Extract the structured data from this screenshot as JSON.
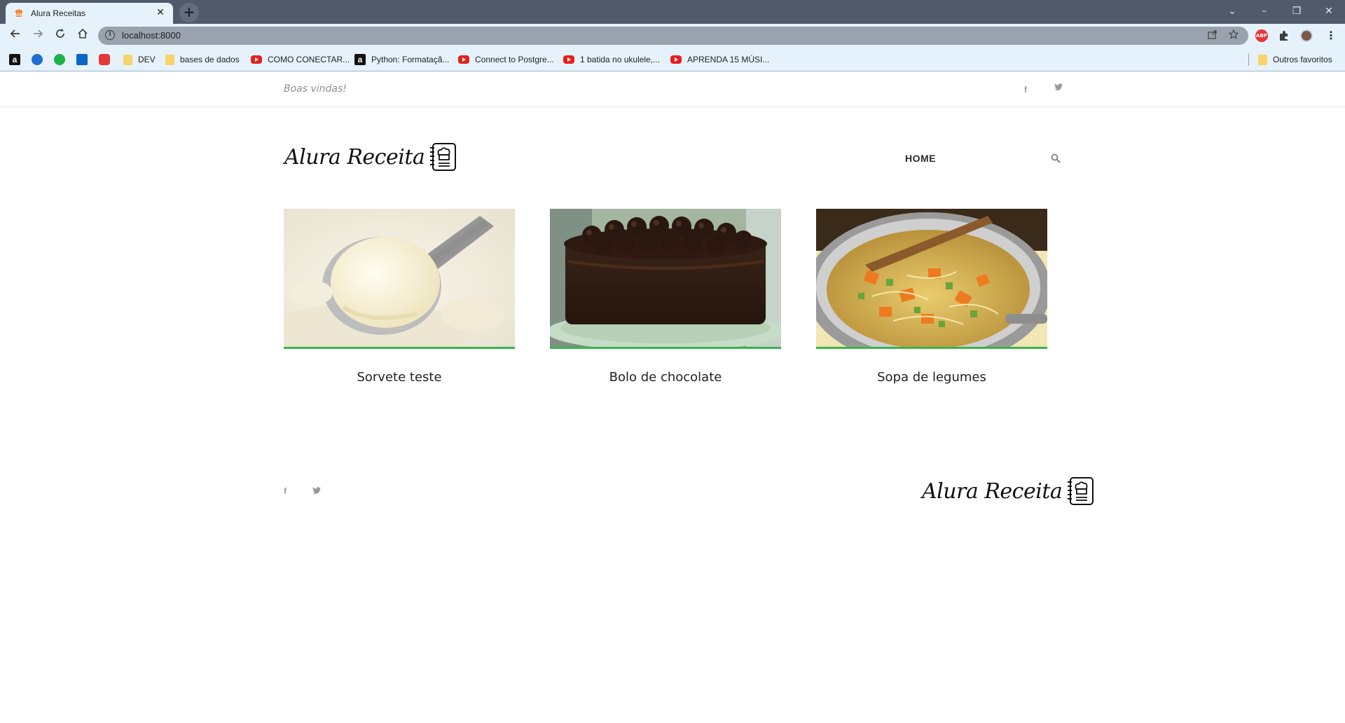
{
  "browser": {
    "tab_title": "Alura Receitas",
    "tab_close": "✕",
    "new_tab": "+",
    "url": "localhost:8000",
    "window_controls": {
      "minimize": "–",
      "restore": "❐",
      "close": "✕",
      "tabs_menu": "⌄"
    },
    "bookmarks": [
      {
        "label": "",
        "icon": "amazon-a"
      },
      {
        "label": "",
        "icon": "w-blue"
      },
      {
        "label": "",
        "icon": "green-1"
      },
      {
        "label": "",
        "icon": "linkedin"
      },
      {
        "label": "",
        "icon": "red-cross"
      },
      {
        "label": "DEV",
        "icon": "folder"
      },
      {
        "label": "bases de dados",
        "icon": "folder"
      },
      {
        "label": "COMO CONECTAR...",
        "icon": "youtube"
      },
      {
        "label": "Python: Formataçã...",
        "icon": "amazon-a"
      },
      {
        "label": "Connect to Postgre...",
        "icon": "youtube"
      },
      {
        "label": "1 batida no ukulele,...",
        "icon": "youtube"
      },
      {
        "label": "APRENDA 15 MÚSI...",
        "icon": "youtube"
      }
    ],
    "other_bookmarks": "Outros favoritos"
  },
  "site": {
    "welcome": "Boas vindas!",
    "social_fb": "f",
    "social_tw": "t",
    "logo_text": "Alura Receita",
    "nav_home": "HOME",
    "recipes": [
      {
        "title": "Sorvete teste",
        "image": "ice-cream"
      },
      {
        "title": "Bolo de chocolate",
        "image": "chocolate-cake"
      },
      {
        "title": "Sopa de legumes",
        "image": "vegetable-soup"
      }
    ]
  },
  "colors": {
    "accent_green": "#3ab54a",
    "tab_bar": "#505a6b",
    "toolbar": "#e6f2fb"
  }
}
